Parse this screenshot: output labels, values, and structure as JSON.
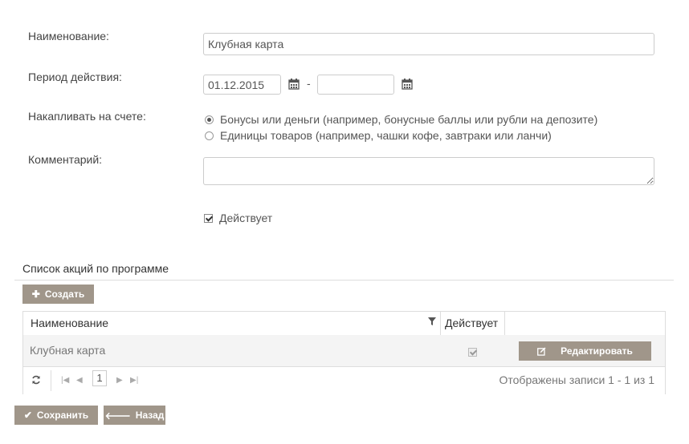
{
  "form": {
    "name_label": "Наименование:",
    "name_value": "Клубная карта",
    "period_label": "Период действия:",
    "period_start": "01.12.2015",
    "period_separator": "-",
    "period_end": "",
    "accumulate_label": "Накапливать на счете:",
    "accumulate_options": [
      {
        "label": "Бонусы или деньги (например, бонусные баллы или рубли на депозите)",
        "checked": true
      },
      {
        "label": "Единицы товаров (например, чашки кофе, завтраки или ланчи)",
        "checked": false
      }
    ],
    "comment_label": "Комментарий:",
    "comment_value": "",
    "active_label": "Действует",
    "active_checked": true
  },
  "promotions": {
    "section_title": "Список акций по программе",
    "create_label": "Создать",
    "columns": {
      "name": "Наименование",
      "active": "Действует"
    },
    "rows": [
      {
        "name": "Клубная карта",
        "active": true,
        "action_label": "Редактировать"
      }
    ],
    "pager": {
      "current_page": "1",
      "summary": "Отображены записи 1 - 1 из 1"
    }
  },
  "footer": {
    "save_label": "Сохранить",
    "back_label": "Назад"
  },
  "icons": {
    "calendar": "calendar-icon",
    "filter": "filter-icon",
    "refresh": "refresh-icon",
    "edit": "edit-icon",
    "plus": "plus-icon",
    "check": "check-icon",
    "arrow_left": "arrow-left-icon"
  },
  "colors": {
    "button_bg": "#a0968a",
    "border": "#dddddd",
    "row_bg": "#f4f4f4"
  }
}
